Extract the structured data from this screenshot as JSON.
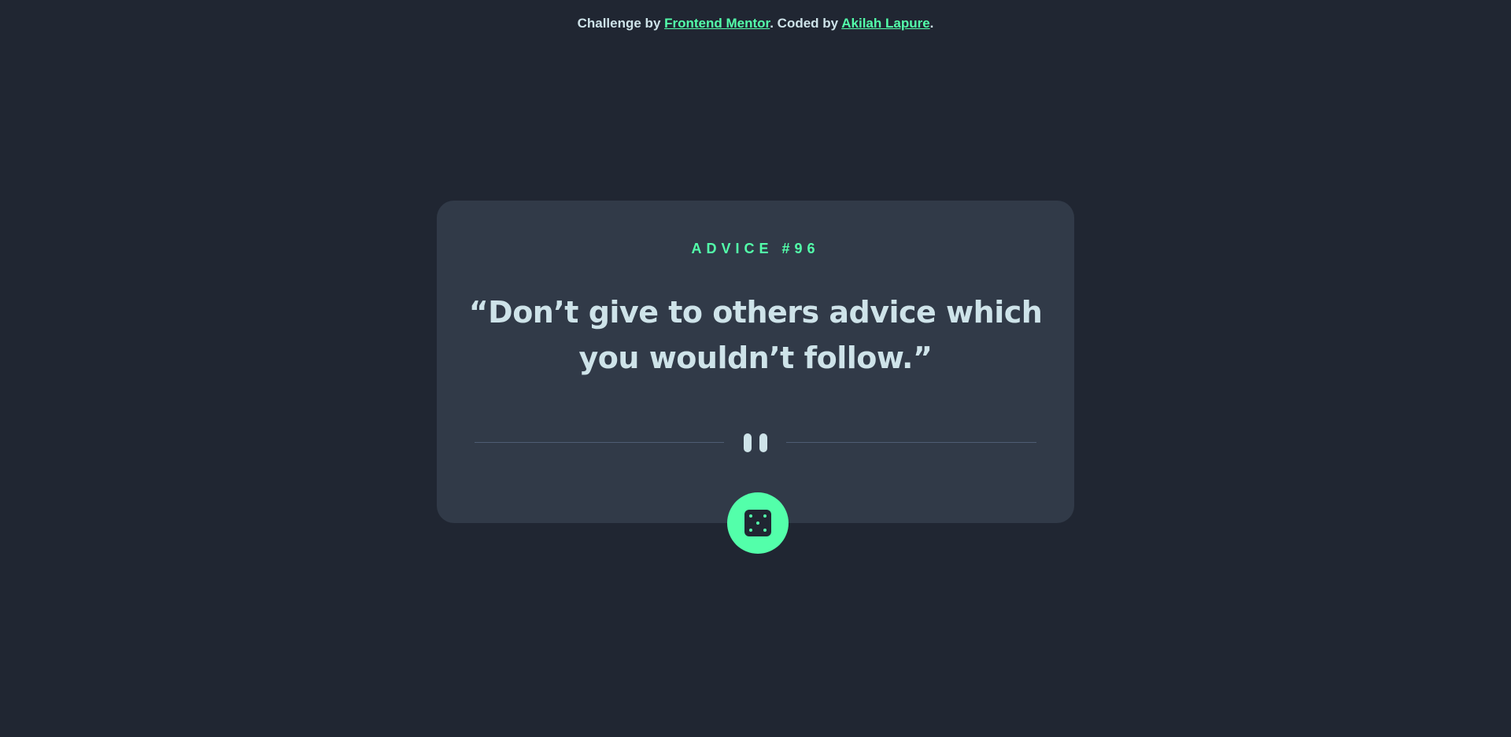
{
  "attribution": {
    "prefix": "Challenge by ",
    "challenge_link": "Frontend Mentor",
    "middle": ". Coded by ",
    "author_link": "Akilah Lapure",
    "suffix": "."
  },
  "advice": {
    "label": "ADVICE #96",
    "text": "“Don’t give to others advice which you wouldn’t follow.”"
  },
  "divider": {
    "icon": "pause-icon"
  },
  "button": {
    "icon": "dice-icon"
  },
  "colors": {
    "background": "#202632",
    "card": "#313a48",
    "accent": "#53ffaa",
    "text": "#cee3e9",
    "divider": "#4f5d74"
  }
}
